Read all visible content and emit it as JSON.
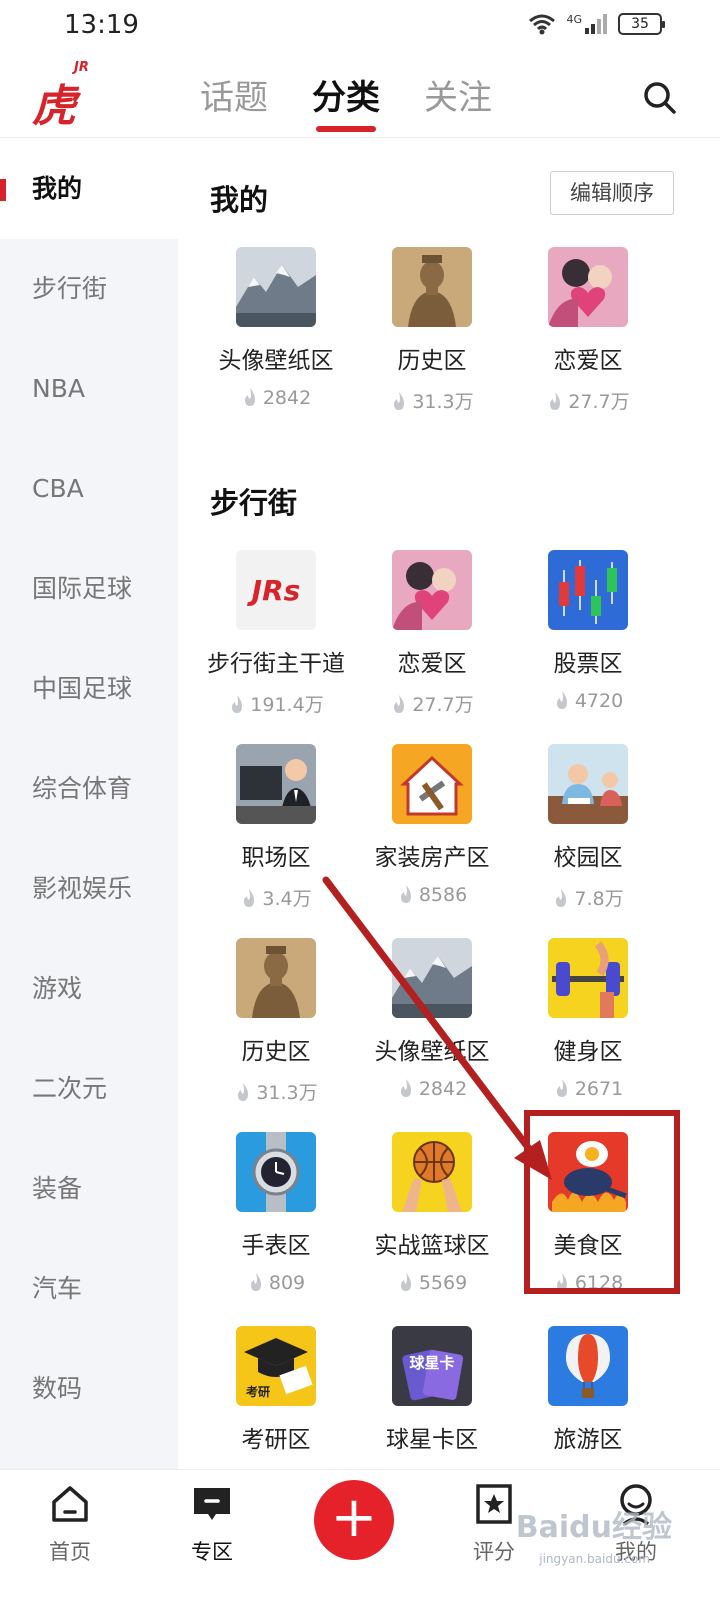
{
  "status": {
    "time": "13:19",
    "network": "4G",
    "battery": "35"
  },
  "header": {
    "logo_text": "虎扑",
    "logo_badge": "JR",
    "tabs": [
      {
        "label": "话题",
        "active": false
      },
      {
        "label": "分类",
        "active": true
      },
      {
        "label": "关注",
        "active": false
      }
    ],
    "search_icon": "search-icon"
  },
  "leftnav": {
    "items": [
      {
        "label": "我的",
        "active": true
      },
      {
        "label": "步行街"
      },
      {
        "label": "NBA"
      },
      {
        "label": "CBA"
      },
      {
        "label": "国际足球"
      },
      {
        "label": "中国足球"
      },
      {
        "label": "综合体育"
      },
      {
        "label": "影视娱乐"
      },
      {
        "label": "游戏"
      },
      {
        "label": "二次元"
      },
      {
        "label": "装备"
      },
      {
        "label": "汽车"
      },
      {
        "label": "数码"
      }
    ]
  },
  "main": {
    "mine": {
      "title": "我的",
      "edit_label": "编辑顺序",
      "cards": [
        {
          "name": "头像壁纸区",
          "heat": "2842",
          "icon": "mountain"
        },
        {
          "name": "历史区",
          "heat": "31.3万",
          "icon": "terracotta"
        },
        {
          "name": "恋爱区",
          "heat": "27.7万",
          "icon": "love"
        }
      ]
    },
    "street": {
      "title": "步行街",
      "cards": [
        {
          "name": "步行街主干道",
          "heat": "191.4万",
          "icon": "jrs"
        },
        {
          "name": "恋爱区",
          "heat": "27.7万",
          "icon": "love"
        },
        {
          "name": "股票区",
          "heat": "4720",
          "icon": "stock"
        },
        {
          "name": "职场区",
          "heat": "3.4万",
          "icon": "office"
        },
        {
          "name": "家装房产区",
          "heat": "8586",
          "icon": "house"
        },
        {
          "name": "校园区",
          "heat": "7.8万",
          "icon": "campus"
        },
        {
          "name": "历史区",
          "heat": "31.3万",
          "icon": "terracotta"
        },
        {
          "name": "头像壁纸区",
          "heat": "2842",
          "icon": "mountain"
        },
        {
          "name": "健身区",
          "heat": "2671",
          "icon": "fitness"
        },
        {
          "name": "手表区",
          "heat": "809",
          "icon": "watch"
        },
        {
          "name": "实战篮球区",
          "heat": "5569",
          "icon": "basketball"
        },
        {
          "name": "美食区",
          "heat": "6128",
          "icon": "food"
        },
        {
          "name": "考研区",
          "heat": "",
          "icon": "exam",
          "icon_text": "考研"
        },
        {
          "name": "球星卡区",
          "heat": "",
          "icon": "cards",
          "icon_text": "球星卡"
        },
        {
          "name": "旅游区",
          "heat": "",
          "icon": "balloon"
        }
      ]
    }
  },
  "bottombar": {
    "items": [
      {
        "label": "首页",
        "icon": "home-icon"
      },
      {
        "label": "专区",
        "icon": "zone-icon",
        "active": true
      },
      {
        "label": "",
        "icon": "plus-icon"
      },
      {
        "label": "评分",
        "icon": "rating-icon"
      },
      {
        "label": "我的",
        "icon": "profile-icon"
      }
    ]
  },
  "watermark": {
    "text": "Baidu经验",
    "sub": "jingyan.baidu.com"
  },
  "colors": {
    "accent": "#d7242a",
    "annotation": "#b3201f",
    "nav_bg": "#f4f5f9"
  }
}
